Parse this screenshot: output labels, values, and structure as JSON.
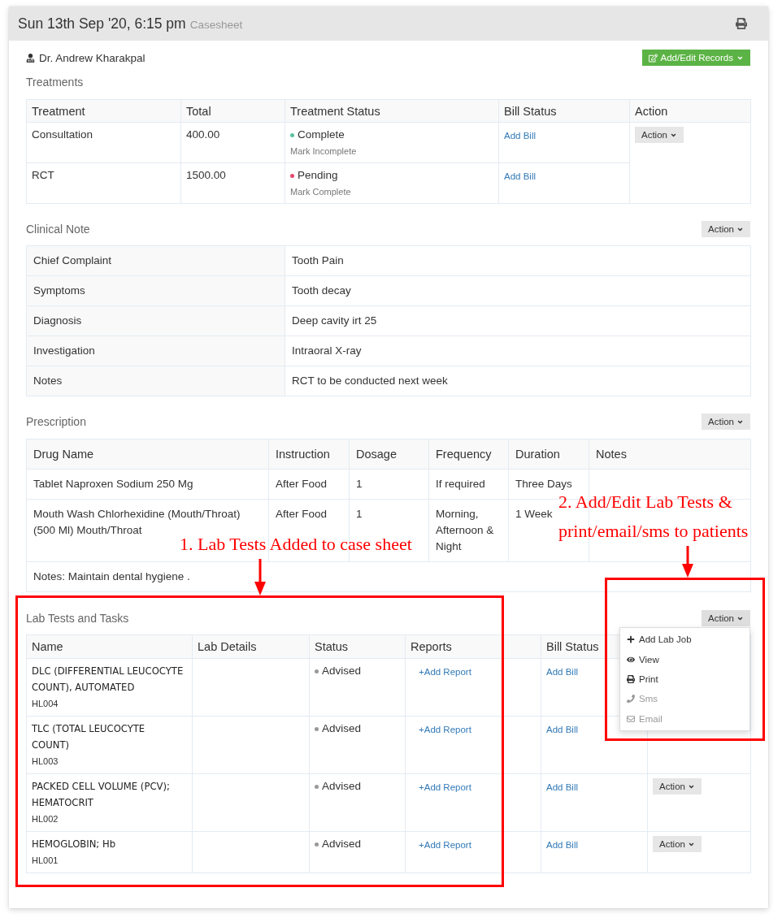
{
  "header": {
    "date": "Sun 13th Sep '20, 6:15 pm",
    "subtitle": "Casesheet"
  },
  "doctor": {
    "name": "Dr. Andrew Kharakpal"
  },
  "records_button": {
    "label": "Add/Edit Records"
  },
  "treatments": {
    "title": "Treatments",
    "columns": [
      "Treatment",
      "Total",
      "Treatment Status",
      "Bill Status",
      "Action"
    ],
    "action": "Action",
    "rows": [
      {
        "treatment": "Consultation",
        "total": "400.00",
        "status": "Complete",
        "color": "#5bc0a0",
        "toggle": "Mark Incomplete",
        "bill": "Add Bill"
      },
      {
        "treatment": "RCT",
        "total": "1500.00",
        "status": "Pending",
        "color": "#e8466c",
        "toggle": "Mark Complete",
        "bill": "Add Bill"
      }
    ]
  },
  "clinical_note": {
    "title": "Clinical Note",
    "action": "Action",
    "rows": [
      {
        "label": "Chief Complaint",
        "value": "Tooth Pain"
      },
      {
        "label": "Symptoms",
        "value": "Tooth decay"
      },
      {
        "label": "Diagnosis",
        "value": "Deep cavity irt 25"
      },
      {
        "label": "Investigation",
        "value": "Intraoral X-ray"
      },
      {
        "label": "Notes",
        "value": "RCT to be conducted next week"
      }
    ]
  },
  "prescription": {
    "title": "Prescription",
    "action": "Action",
    "columns": [
      "Drug Name",
      "Instruction",
      "Dosage",
      "Frequency",
      "Duration",
      "Notes"
    ],
    "rows": [
      {
        "drug": "Tablet Naproxen Sodium 250 Mg",
        "instruction": "After Food",
        "dosage": "1",
        "frequency": "If required",
        "duration": "Three Days"
      },
      {
        "drug": "Mouth Wash Chlorhexidine (Mouth/Throat) (500 Ml) Mouth/Throat",
        "instruction": "After Food",
        "dosage": "1",
        "frequency": "Morning, Afternoon & Night",
        "duration": "1 Week"
      }
    ],
    "notes": "Notes: Maintain dental hygiene ."
  },
  "lab_tests": {
    "title": "Lab Tests and Tasks",
    "action": {
      "label": "Action",
      "expanded": true,
      "menu": [
        {
          "label": "Add Lab Job",
          "disabled": false
        },
        {
          "label": "View",
          "disabled": false
        },
        {
          "label": "Print",
          "disabled": false
        },
        {
          "label": "Sms",
          "disabled": true
        },
        {
          "label": "Email",
          "disabled": true
        }
      ]
    },
    "columns": [
      "Name",
      "Lab Details",
      "Status",
      "Reports",
      "Bill Status"
    ],
    "rows": [
      {
        "name": "DLC (DIFFERENTIAL LEUCOCYTE COUNT), AUTOMATED",
        "code": "HL004",
        "status": "Advised",
        "color": "#999999",
        "report": "+Add Report",
        "bill": "Add Bill"
      },
      {
        "name": "TLC (TOTAL LEUCOCYTE COUNT)",
        "code": "HL003",
        "status": "Advised",
        "color": "#999999",
        "report": "+Add Report",
        "bill": "Add Bill"
      },
      {
        "name": "PACKED CELL VOLUME (PCV); HEMATOCRIT",
        "code": "HL002",
        "status": "Advised",
        "color": "#999999",
        "report": "+Add Report",
        "bill": "Add Bill",
        "action": "Action"
      },
      {
        "name": "HEMOGLOBIN; Hb",
        "code": "HL001",
        "status": "Advised",
        "color": "#999999",
        "report": "+Add Report",
        "bill": "Add Bill",
        "action": "Action"
      }
    ]
  },
  "annotations": [
    {
      "text": "1. Lab Tests Added to case sheet"
    },
    {
      "text": "2. Add/Edit Lab Tests & print/email/sms to patients"
    }
  ]
}
